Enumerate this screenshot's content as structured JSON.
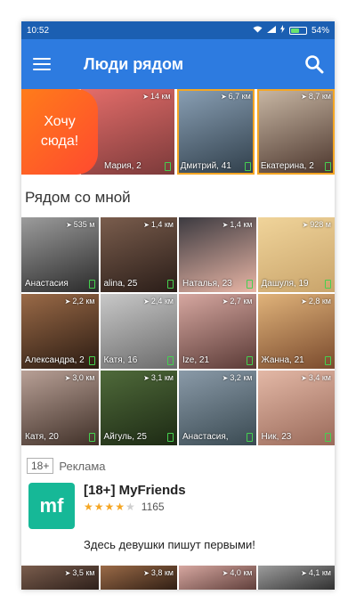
{
  "status_bar": {
    "time": "10:52",
    "battery": "54%"
  },
  "app_bar": {
    "title": "Люди рядом"
  },
  "featured": {
    "want_here_label": "Хочу сюда!",
    "items": [
      {
        "distance": "14 км",
        "name": "Мария, 2"
      },
      {
        "distance": "6,7 км",
        "name": "Дмитрий, 41"
      },
      {
        "distance": "8,7 км",
        "name": "Екатерина, 2"
      }
    ]
  },
  "nearby": {
    "title": "Рядом со мной",
    "people": [
      {
        "distance": "535 м",
        "name": "Анастасия"
      },
      {
        "distance": "1,4 км",
        "name": "alina, 25"
      },
      {
        "distance": "1,4 км",
        "name": "Наталья, 23"
      },
      {
        "distance": "928 м",
        "name": "Дашуля, 19"
      },
      {
        "distance": "2,2 км",
        "name": "Александра, 2"
      },
      {
        "distance": "2,4 км",
        "name": "Катя, 16"
      },
      {
        "distance": "2,7 км",
        "name": "Ize, 21"
      },
      {
        "distance": "2,8 км",
        "name": "Жанна, 21"
      },
      {
        "distance": "3,0 км",
        "name": "Катя, 20"
      },
      {
        "distance": "3,1 км",
        "name": "Айгуль, 25"
      },
      {
        "distance": "3,2 км",
        "name": "Анастасия,"
      },
      {
        "distance": "3,4 км",
        "name": "Ник, 23"
      }
    ]
  },
  "ad": {
    "age_badge": "18+",
    "label": "Реклама",
    "logo_text": "mf",
    "name": "[18+] MyFriends",
    "rating_count": "1165",
    "description": "Здесь девушки пишут первыми!"
  },
  "bottom_row": [
    {
      "distance": "3,5 км"
    },
    {
      "distance": "3,8 км"
    },
    {
      "distance": "4,0 км"
    },
    {
      "distance": "4,1 км"
    }
  ],
  "colors": {
    "status_bar": "#1b5fb2",
    "app_bar": "#2d7be0",
    "want_gradient_start": "#ff7c1a",
    "ad_logo": "#16b897",
    "online": "#45d04f"
  }
}
